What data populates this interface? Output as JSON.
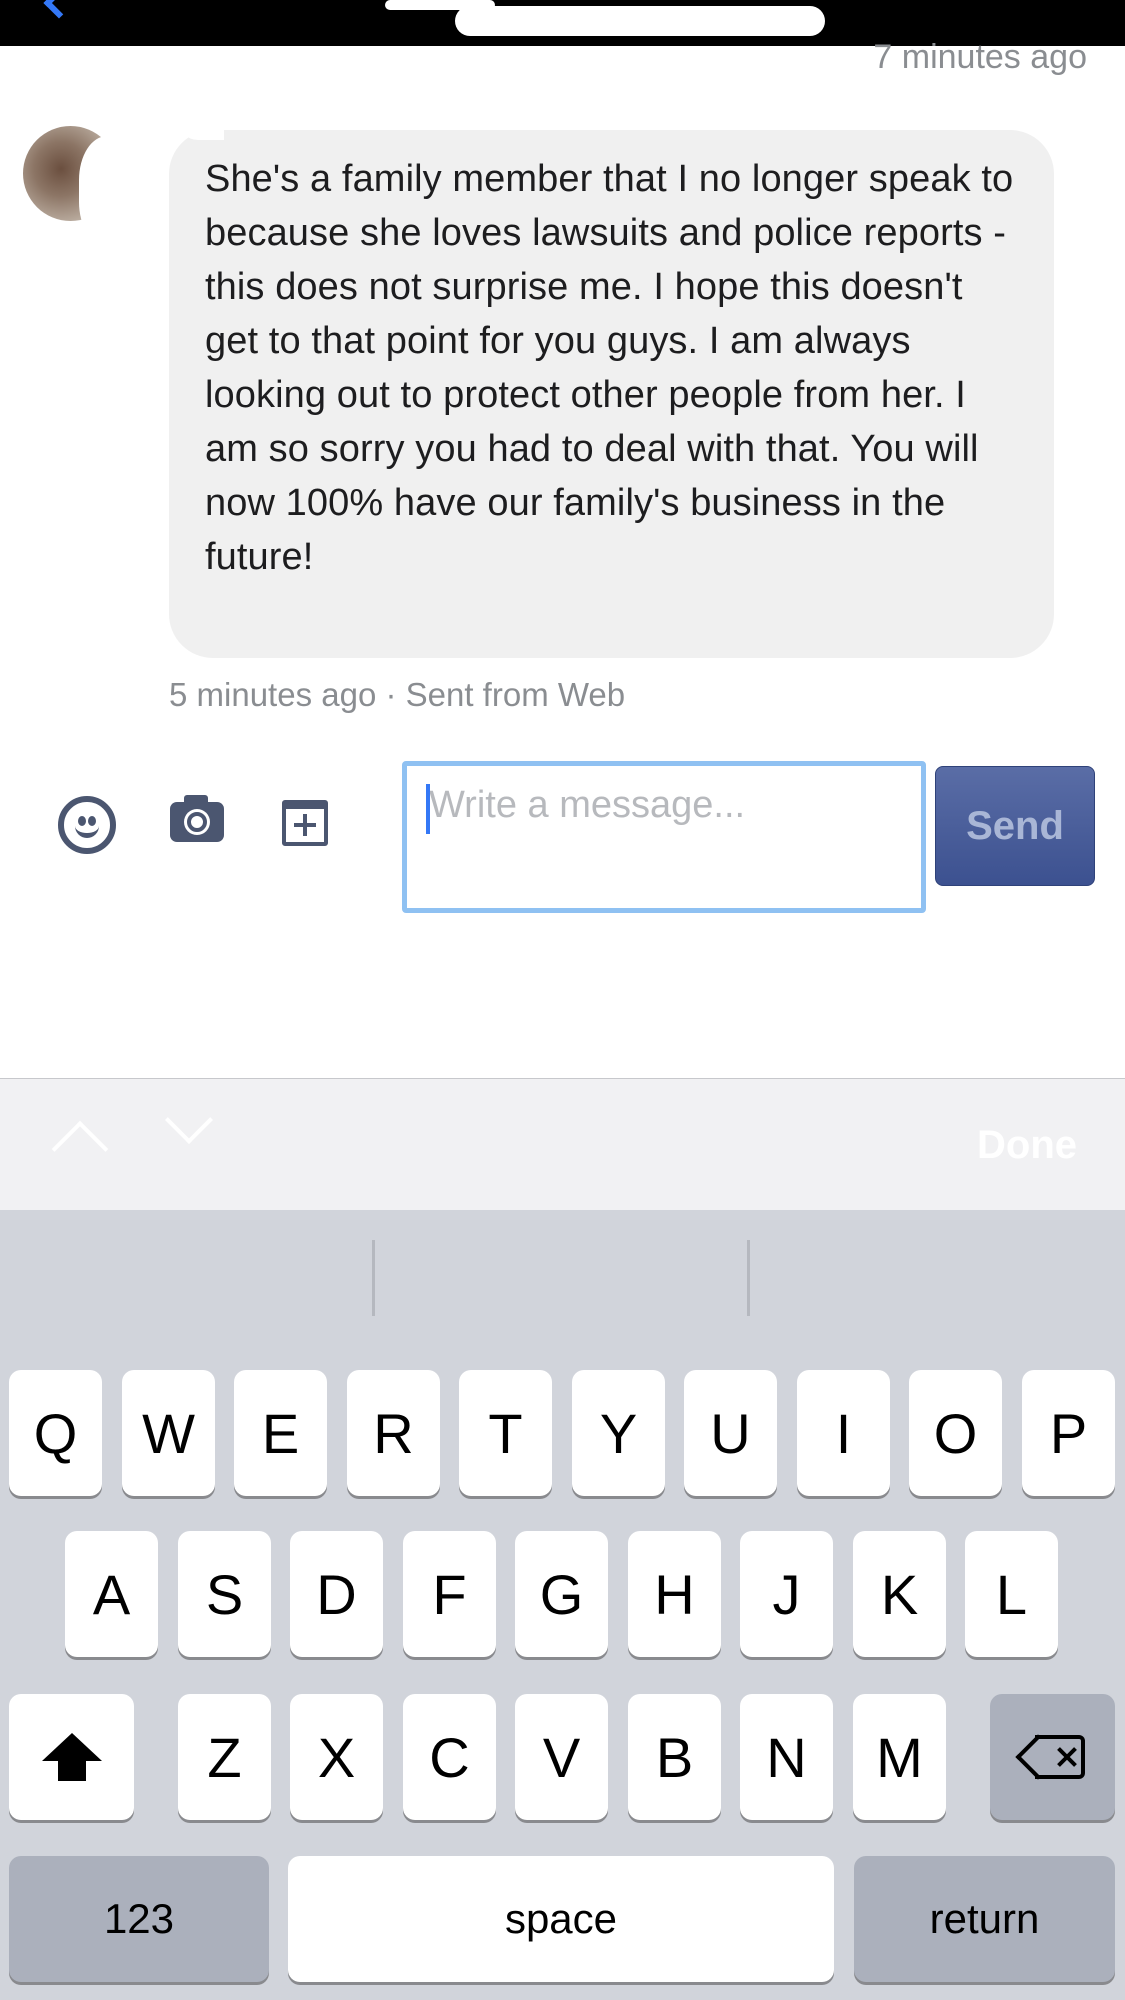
{
  "conversation": {
    "top_timestamp": "7 minutes ago",
    "message": {
      "text": "She's a family member that I no longer speak to because she loves lawsuits and police reports - this does not surprise me. I hope this doesn't get to that point for you guys. I am always looking out to protect other people from her. I am so sorry you had to deal with that. You will now 100% have our family's business in the future!",
      "meta": "5 minutes ago · Sent from Web"
    }
  },
  "composer": {
    "icons": [
      "smile-icon",
      "camera-icon",
      "sticker-icon"
    ],
    "placeholder": "Write a message...",
    "value": "",
    "send_label": "Send"
  },
  "accessory": {
    "done_label": "Done",
    "icons": [
      "chevron-up-icon",
      "chevron-down-icon"
    ]
  },
  "keyboard": {
    "row1": [
      "Q",
      "W",
      "E",
      "R",
      "T",
      "Y",
      "U",
      "I",
      "O",
      "P"
    ],
    "row2": [
      "A",
      "S",
      "D",
      "F",
      "G",
      "H",
      "J",
      "K",
      "L"
    ],
    "row3": [
      "Z",
      "X",
      "C",
      "V",
      "B",
      "N",
      "M"
    ],
    "numbers_label": "123",
    "space_label": "space",
    "return_label": "return"
  },
  "colors": {
    "accent": "#3478f6",
    "send_button": "#3c5190",
    "bubble": "#f0f0f0",
    "keyboard_bg": "#d1d4db"
  }
}
